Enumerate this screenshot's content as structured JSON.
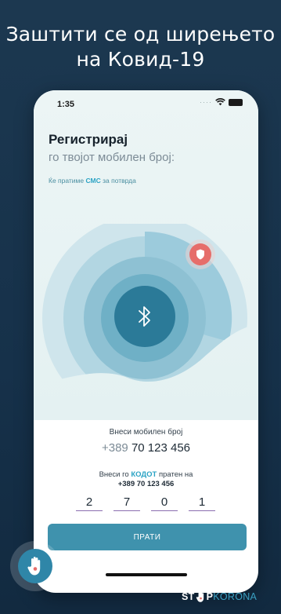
{
  "promo": {
    "headline_line1": "Заштити се од ширењето",
    "headline_line2": "на Ковид-19"
  },
  "status_bar": {
    "time": "1:35"
  },
  "registration": {
    "title": "Регистрирај",
    "subtitle": "го твојот мобилен број:",
    "sms_note_prefix": "Ќе пратиме ",
    "sms_note_sms": "СМС",
    "sms_note_suffix": " за потврда"
  },
  "phone_entry": {
    "label": "Внеси мобилен број",
    "prefix": "+389",
    "number": "70 123 456"
  },
  "code_entry": {
    "label_prefix": "Внеси го ",
    "label_kodot": "КОДОТ",
    "label_suffix": " пратен на",
    "label_number": "+389 70 123 456",
    "digits": [
      "2",
      "7",
      "0",
      "1"
    ]
  },
  "send_button": {
    "label": "ПРАТИ"
  },
  "brand": {
    "st": "ST",
    "p": "P",
    "korona": "KORONA"
  },
  "colors": {
    "background": "#1c3850",
    "accent": "#3f92ad",
    "bluetooth_circle": "#2b7a98",
    "shield_red": "#e66d6a",
    "code_underline": "#8a6db0",
    "korona_blue": "#3aa0c2"
  },
  "icons": {
    "bluetooth": "bluetooth-icon",
    "shield": "shield-icon",
    "hand": "hand-icon",
    "wifi": "wifi-icon",
    "battery": "battery-icon"
  }
}
